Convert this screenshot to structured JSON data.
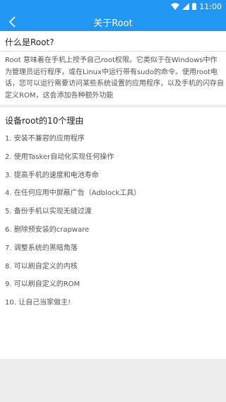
{
  "status_bar": {
    "time": "11:00"
  },
  "app_bar": {
    "title": "关于Root"
  },
  "intro": {
    "heading": "什么是Root?",
    "body": "Root 意味着在手机上授予自己root权限。它类似于在Windows中作为管理员运行程序，或在Linux中运行带有sudo的命令。使用root电话，您可以运行需要访问某些系统设置的应用程序，以及手机的闪存自定义ROM，这会添加各种额外功能"
  },
  "reasons": {
    "heading": "设备root的10个理由",
    "items": [
      "1. 安装不兼容的应用程序",
      "2. 使用Tasker自动化实现任何操作",
      "3. 提高手机的速度和电池寿命",
      "4. 在任何应用中屏蔽广告（Adblock工具）",
      "5. 备份手机以实现无缝过渡",
      "6. 删除预安装的crapware",
      "7. 调整系统的黑暗角落",
      "8. 可以刷自定义的内核",
      "9. 可以刷自定义的ROM",
      "10. 让自己当家做主!"
    ]
  },
  "colors": {
    "accent": "#2196f3",
    "background": "#ededed",
    "card": "#ffffff"
  },
  "icons": {
    "back": "chevron-left-icon",
    "wifi": "wifi-icon",
    "signal": "signal-icon",
    "battery": "battery-icon"
  }
}
